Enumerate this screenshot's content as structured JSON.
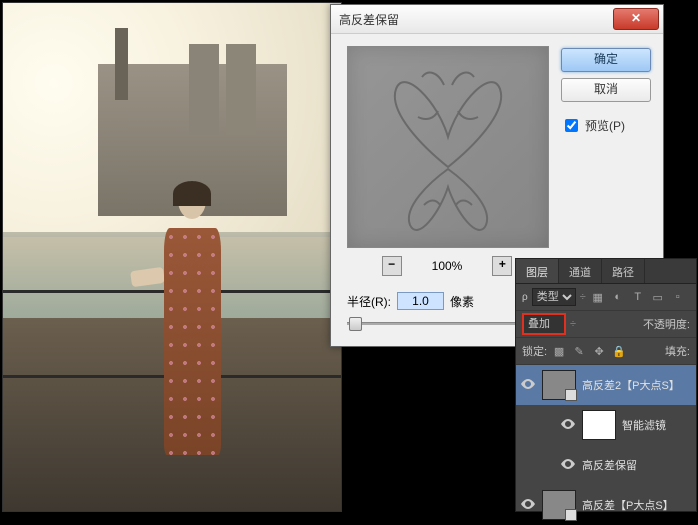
{
  "dialog": {
    "title": "高反差保留",
    "ok": "确定",
    "cancel": "取消",
    "preview_label": "预览(P)",
    "zoom": "100%",
    "radius_label": "半径(R):",
    "radius_value": "1.0",
    "radius_unit": "像素"
  },
  "panel": {
    "tabs": {
      "layers": "图层",
      "channels": "通道",
      "paths": "路径"
    },
    "filter_kind": "类型",
    "blend_mode": "叠加",
    "opacity_label": "不透明度:",
    "lock_label": "锁定:",
    "fill_label": "填充:",
    "layers": [
      {
        "name": "高反差2【P大点S】",
        "selected": true
      },
      {
        "name": "智能滤镜",
        "sub": true
      },
      {
        "name": "高反差保留",
        "sub": true
      },
      {
        "name": "高反差【P大点S】"
      }
    ]
  }
}
